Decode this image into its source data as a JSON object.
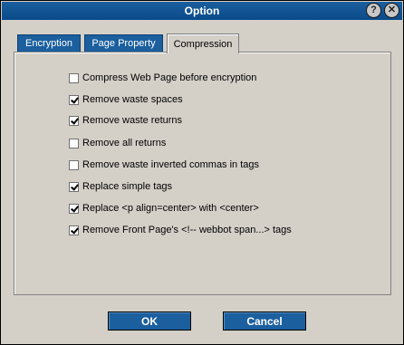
{
  "window": {
    "title": "Option",
    "help_symbol": "?",
    "close_symbol": "✕"
  },
  "tabs": [
    {
      "label": "Encryption",
      "active": false
    },
    {
      "label": "Page Property",
      "active": false
    },
    {
      "label": "Compression",
      "active": true
    }
  ],
  "options": [
    {
      "label": "Compress Web Page before encryption",
      "checked": false
    },
    {
      "label": "Remove waste spaces",
      "checked": true
    },
    {
      "label": "Remove waste returns",
      "checked": true
    },
    {
      "label": "Remove all returns",
      "checked": false
    },
    {
      "label": "Remove waste inverted commas in tags",
      "checked": false
    },
    {
      "label": "Replace simple tags",
      "checked": true
    },
    {
      "label": "Replace <p align=center> with <center>",
      "checked": true
    },
    {
      "label": "Remove Front Page's <!-- webbot span...> tags",
      "checked": true
    }
  ],
  "buttons": {
    "ok": "OK",
    "cancel": "Cancel"
  },
  "colors": {
    "accent": "#1b5f9e",
    "dialog_bg": "#d4d0c8"
  }
}
